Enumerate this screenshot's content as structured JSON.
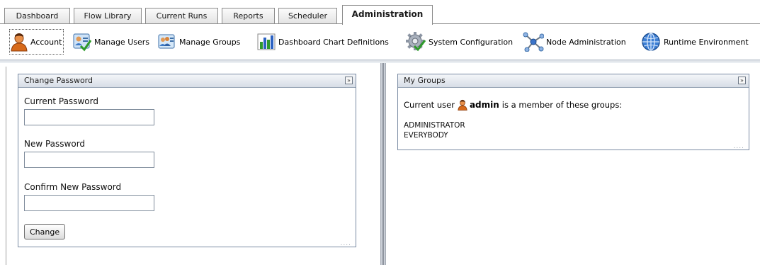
{
  "tabs": [
    {
      "label": "Dashboard",
      "active": false
    },
    {
      "label": "Flow Library",
      "active": false
    },
    {
      "label": "Current Runs",
      "active": false
    },
    {
      "label": "Reports",
      "active": false
    },
    {
      "label": "Scheduler",
      "active": false
    },
    {
      "label": "Administration",
      "active": true
    }
  ],
  "toolbar": {
    "items": [
      {
        "label": "Account",
        "icon": "user-icon",
        "active": true
      },
      {
        "label": "Manage Users",
        "icon": "manage-users-icon"
      },
      {
        "label": "Manage Groups",
        "icon": "manage-groups-icon"
      },
      {
        "label": "Dashboard Chart Definitions",
        "icon": "bar-chart-icon"
      },
      {
        "label": "System Configuration",
        "icon": "gear-icon"
      },
      {
        "label": "Node Administration",
        "icon": "nodes-icon"
      },
      {
        "label": "Runtime Environment",
        "icon": "globe-icon"
      }
    ]
  },
  "change_password": {
    "title": "Change Password",
    "current_label": "Current Password",
    "current_value": "",
    "new_label": "New Password",
    "new_value": "",
    "confirm_label": "Confirm New Password",
    "confirm_value": "",
    "submit_label": "Change"
  },
  "my_groups": {
    "title": "My Groups",
    "prefix": "Current user",
    "username": "admin",
    "suffix": "is a member of these groups:",
    "groups": [
      "ADMINISTRATOR",
      "EVERYBODY"
    ]
  },
  "colors": {
    "portlet_border": "#7a8ba3",
    "portlet_header": "#d7dde6",
    "user_icon_orange": "#d86a1a"
  }
}
